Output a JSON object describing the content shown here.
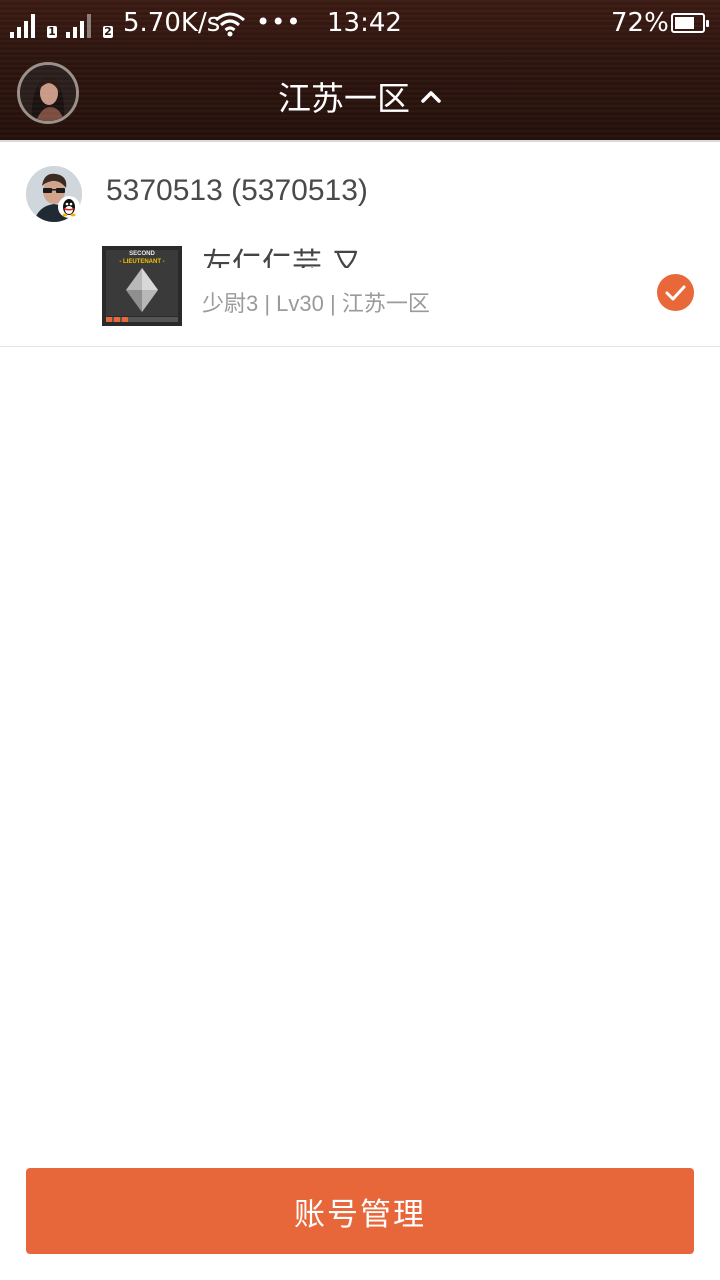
{
  "status_bar": {
    "sim1": "1",
    "sim2": "2",
    "speed": "5.70K/s",
    "dots": "•••",
    "time": "13:42",
    "battery": "72%",
    "battery_level": 0.72,
    "icons": [
      "signal-icon",
      "wifi-icon",
      "battery-icon"
    ]
  },
  "header": {
    "title": "江苏一区",
    "chevron_icon": "chevron-up-icon"
  },
  "account": {
    "name": "5370513 (5370513)",
    "role": {
      "name": "左仁仁芸 又",
      "rank_image_text": [
        "SECOND",
        "- LIEUTENANT -"
      ],
      "info": "少尉3 | Lv30 | 江苏一区",
      "selected": true
    }
  },
  "footer": {
    "manage_label": "账号管理"
  },
  "colors": {
    "accent": "#e8673a",
    "header_bg": "#2d140e"
  }
}
